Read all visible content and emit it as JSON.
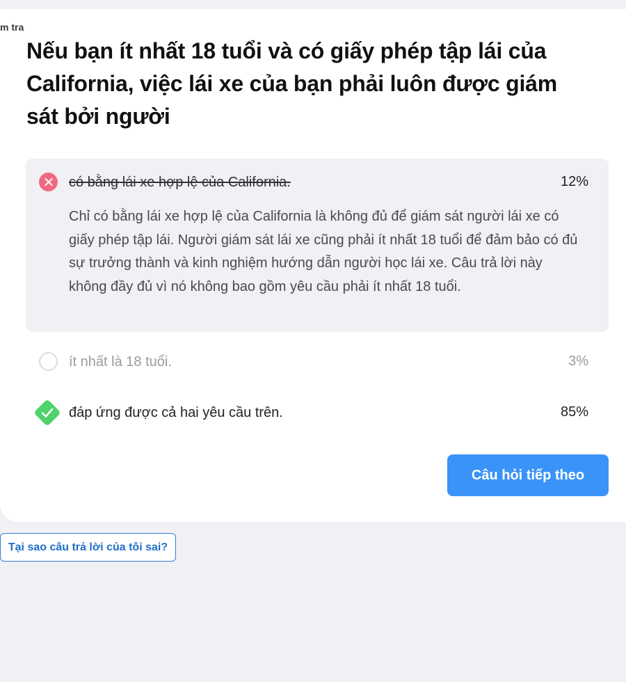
{
  "header": {
    "corner_label": "m tra"
  },
  "question": {
    "text": "Nếu bạn ít nhất 18 tuổi và có giấy phép tập lái của California, việc lái xe của bạn phải luôn được giám sát bởi người"
  },
  "options": [
    {
      "label": "có bằng lái xe hợp lệ của California.",
      "percent": "12%",
      "state": "wrong",
      "icon": "x-circle-icon",
      "explanation": "Chỉ có bằng lái xe hợp lệ của California là không đủ để giám sát người lái xe có giấy phép tập lái. Người giám sát lái xe cũng phải ít nhất 18 tuổi để đảm bảo có đủ sự trưởng thành và kinh nghiệm hướng dẫn người học lái xe. Câu trả lời này không đầy đủ vì nó không bao gồm yêu cầu phải ít nhất 18 tuổi."
    },
    {
      "label": "ít nhất là 18 tuổi.",
      "percent": "3%",
      "state": "unselected",
      "icon": "empty-circle-icon"
    },
    {
      "label": "đáp ứng được cả hai yêu cầu trên.",
      "percent": "85%",
      "state": "correct",
      "icon": "check-diamond-icon"
    }
  ],
  "actions": {
    "next_label": "Câu hỏi tiếp theo",
    "why_label": "Tại sao câu trả lời của tôi sai?"
  },
  "colors": {
    "wrong": "#f06a7e",
    "correct": "#4fd26b",
    "primary": "#3a93f7",
    "link": "#1f6fc9",
    "page_bg": "#f0f0f5"
  }
}
